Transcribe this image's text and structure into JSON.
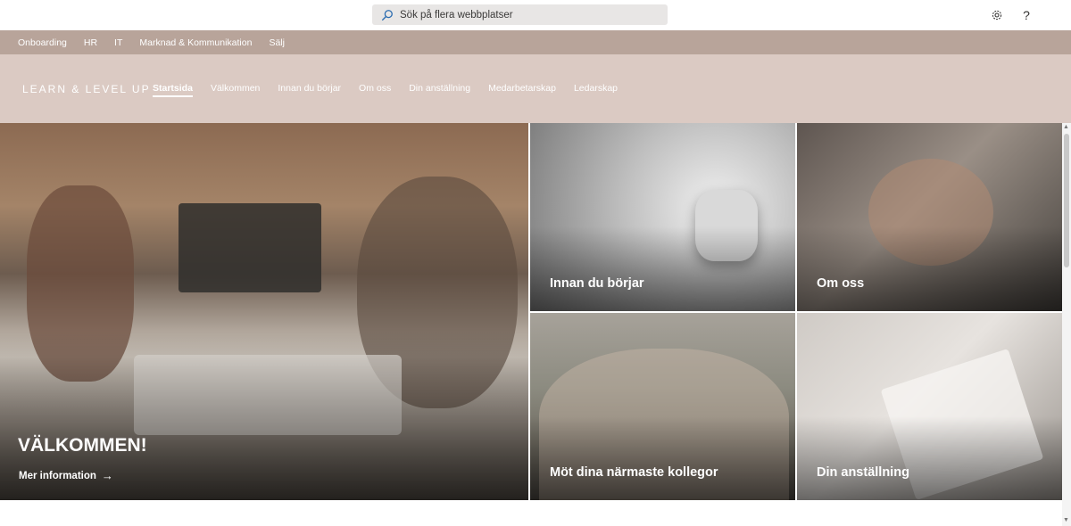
{
  "search": {
    "placeholder": "Sök på flera webbplatser"
  },
  "suite": {
    "settings_icon": "gear-icon",
    "help_label": "?"
  },
  "hub_nav": {
    "items": [
      "Onboarding",
      "HR",
      "IT",
      "Marknad & Kommunikation",
      "Sälj"
    ]
  },
  "site": {
    "title": "LEARN & LEVEL UP",
    "nav": [
      "Startsida",
      "Välkommen",
      "Innan du börjar",
      "Om oss",
      "Din anställning",
      "Medarbetarskap",
      "Ledarskap"
    ],
    "active": "Startsida"
  },
  "hero": {
    "main_title": "VÄLKOMMEN!",
    "main_link": "Mer information",
    "main_link_icon": "arrow-right-icon",
    "tiles": [
      "Innan du börjar",
      "Om oss",
      "Möt dina närmaste kollegor",
      "Din anställning"
    ]
  },
  "colors": {
    "hub_bar": "#b8a49a",
    "site_header": "#dbcac3",
    "search_bg": "#e8e6e5"
  }
}
